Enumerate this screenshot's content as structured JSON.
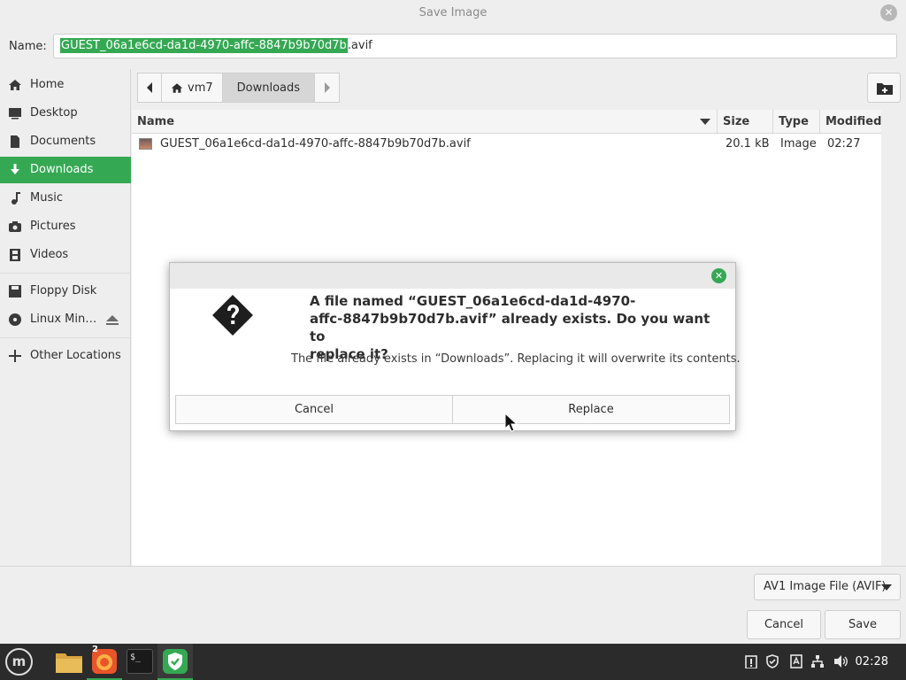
{
  "window": {
    "title": "Save Image"
  },
  "name_row": {
    "label": "Name:",
    "selected_text": "GUEST_06a1e6cd-da1d-4970-affc-8847b9b70d7b",
    "extension": ".avif"
  },
  "sidebar": {
    "items": [
      {
        "label": "Home",
        "icon": "home-icon"
      },
      {
        "label": "Desktop",
        "icon": "desktop-icon"
      },
      {
        "label": "Documents",
        "icon": "documents-icon"
      },
      {
        "label": "Downloads",
        "icon": "downloads-icon",
        "active": true
      },
      {
        "label": "Music",
        "icon": "music-icon"
      },
      {
        "label": "Pictures",
        "icon": "pictures-icon"
      },
      {
        "label": "Videos",
        "icon": "videos-icon"
      },
      {
        "label": "Floppy Disk",
        "icon": "floppy-icon"
      },
      {
        "label": "Linux Min…",
        "icon": "disc-icon"
      },
      {
        "label": "Other Locations",
        "icon": "plus-icon"
      }
    ]
  },
  "pathbar": {
    "segments": [
      "vm7",
      "Downloads"
    ]
  },
  "file_list": {
    "columns": [
      "Name",
      "Size",
      "Type",
      "Modified"
    ],
    "rows": [
      {
        "name": "GUEST_06a1e6cd-da1d-4970-affc-8847b9b70d7b.avif",
        "size": "20.1 kB",
        "type": "Image",
        "modified": "02:27"
      }
    ]
  },
  "bottom": {
    "filter": "AV1 Image File (AVIF)",
    "cancel": "Cancel",
    "save": "Save"
  },
  "dialog": {
    "primary": "A file named “GUEST_06a1e6cd-da1d-4970-affc-8847b9b70d7b.avif” already exists.  Do you want to replace it?",
    "primary_line1": "A file named “GUEST_06a1e6cd-da1d-4970-",
    "primary_line2": "affc-8847b9b70d7b.avif” already exists.  Do you want to",
    "primary_line3": "replace it?",
    "secondary": "The file already exists in “Downloads”.  Replacing it will overwrite its contents.",
    "cancel": "Cancel",
    "replace": "Replace"
  },
  "taskbar": {
    "clock": "02:28",
    "firefox_badge": "2",
    "terminal_glyph": "$_"
  },
  "colors": {
    "accent": "#35a853",
    "taskbar": "#2b2b2b"
  }
}
